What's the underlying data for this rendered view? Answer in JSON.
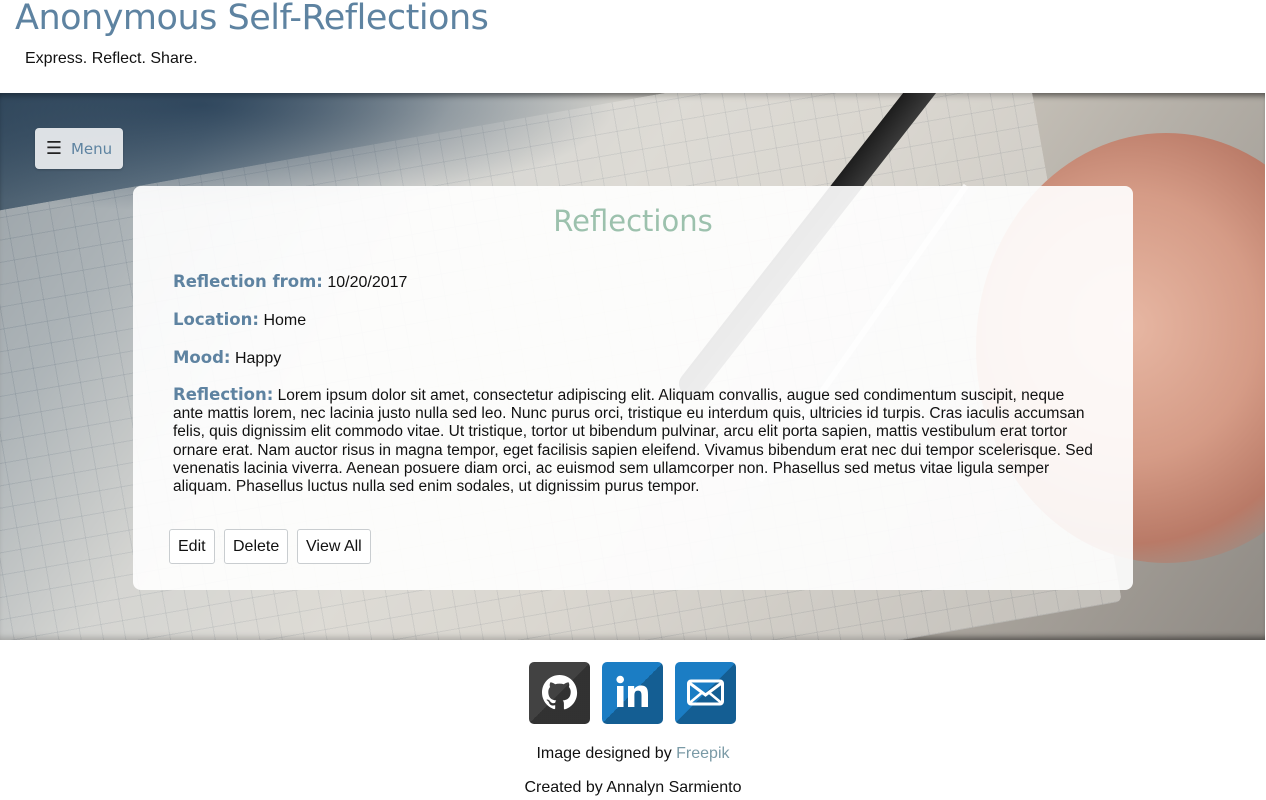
{
  "header": {
    "title": "Anonymous Self-Reflections",
    "tagline": "Express. Reflect. Share."
  },
  "menu": {
    "icon": "hamburger-icon",
    "label": "Menu"
  },
  "card": {
    "title": "Reflections",
    "fields": {
      "date_label": "Reflection from:",
      "date_value": "10/20/2017",
      "location_label": "Location:",
      "location_value": "Home",
      "mood_label": "Mood:",
      "mood_value": "Happy",
      "reflection_label": "Reflection:",
      "reflection_value": "Lorem ipsum dolor sit amet, consectetur adipiscing elit. Aliquam convallis, augue sed condimentum suscipit, neque ante mattis lorem, nec lacinia justo nulla sed leo. Nunc purus orci, tristique eu interdum quis, ultricies id turpis. Cras iaculis accumsan felis, quis dignissim elit commodo vitae. Ut tristique, tortor ut bibendum pulvinar, arcu elit porta sapien, mattis vestibulum erat tortor ornare erat. Nam auctor risus in magna tempor, eget facilisis sapien eleifend. Vivamus bibendum erat nec dui tempor scelerisque. Sed venenatis lacinia viverra. Aenean posuere diam orci, ac euismod sem ullamcorper non. Phasellus sed metus vitae ligula semper aliquam. Phasellus luctus nulla sed enim sodales, ut dignissim purus tempor."
    },
    "buttons": {
      "edit": "Edit",
      "delete": "Delete",
      "view_all": "View All"
    }
  },
  "footer": {
    "social": [
      {
        "icon": "github-icon",
        "color": "#424242"
      },
      {
        "icon": "linkedin-icon",
        "color": "#1b7dc4"
      },
      {
        "icon": "email-icon",
        "color": "#1b7dc4"
      }
    ],
    "image_credit_prefix": "Image designed by",
    "image_credit_link": "Freepik",
    "created_by": "Created by Annalyn Sarmiento"
  },
  "colors": {
    "accent_blue": "#5e83a1",
    "title_green": "#9cc1ad",
    "link": "#7a9aa6"
  }
}
